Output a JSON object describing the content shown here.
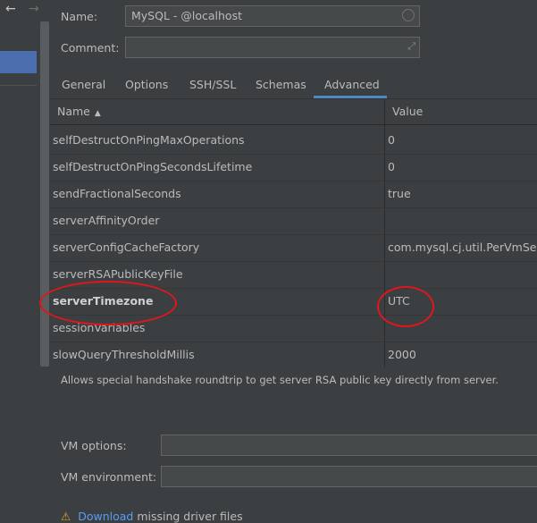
{
  "nav": {
    "back_glyph": "←",
    "forward_glyph": "→"
  },
  "form": {
    "name_label": "Name:",
    "name_value": "MySQL - @localhost",
    "comment_label": "Comment:",
    "comment_value": ""
  },
  "tabs": [
    {
      "label": "General"
    },
    {
      "label": "Options"
    },
    {
      "label": "SSH/SSL"
    },
    {
      "label": "Schemas"
    },
    {
      "label": "Advanced",
      "active": true
    }
  ],
  "table": {
    "columns": {
      "name": "Name",
      "value": "Value",
      "sort_glyph": "▲"
    },
    "rows": [
      {
        "name": "selfDestructOnPingMaxOperations",
        "value": "0"
      },
      {
        "name": "selfDestructOnPingSecondsLifetime",
        "value": "0"
      },
      {
        "name": "sendFractionalSeconds",
        "value": "true"
      },
      {
        "name": "serverAffinityOrder",
        "value": ""
      },
      {
        "name": "serverConfigCacheFactory",
        "value": "com.mysql.cj.util.PerVmServe"
      },
      {
        "name": "serverRSAPublicKeyFile",
        "value": ""
      },
      {
        "name": "serverTimezone",
        "value": "UTC",
        "bold": true
      },
      {
        "name": "sessionVariables",
        "value": ""
      },
      {
        "name": "slowQueryThresholdMillis",
        "value": "2000"
      }
    ]
  },
  "description": "Allows special handshake roundtrip to get server RSA public key directly from server.",
  "vm": {
    "options_label": "VM options:",
    "options_value": "",
    "environment_label": "VM environment:",
    "environment_value": ""
  },
  "warning": {
    "link_text": "Download",
    "rest_text": " missing driver files"
  },
  "icons": {
    "expand": "expand-icon",
    "circle": "circle-icon",
    "warning": "warning-icon"
  },
  "colors": {
    "accent": "#4a88c7",
    "annotation": "#e0161c",
    "link": "#589df6",
    "warning": "#e0a02c"
  }
}
